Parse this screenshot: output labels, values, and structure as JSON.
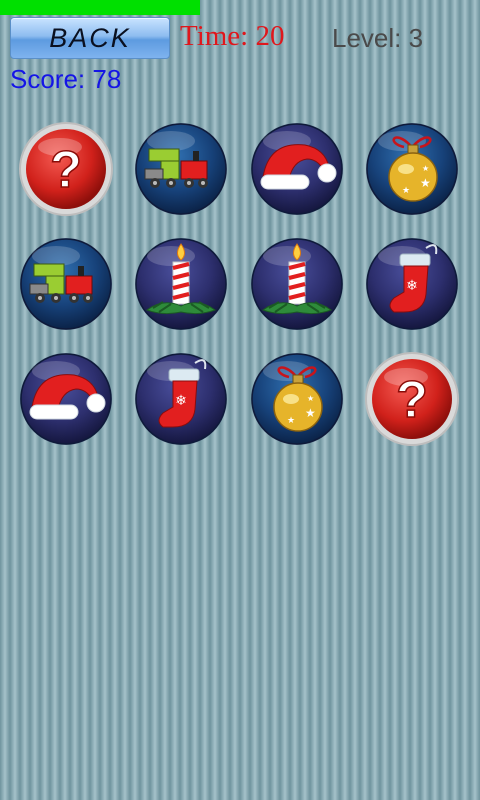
{
  "header": {
    "back_label": "BACK",
    "time_text": "Time: 20",
    "level_text": "Level: 3",
    "score_text": "Score: 78"
  },
  "grid": {
    "columns": 4,
    "cards": [
      {
        "face": "question",
        "revealed": false
      },
      {
        "face": "train",
        "revealed": true
      },
      {
        "face": "santa-hat",
        "revealed": true
      },
      {
        "face": "ornament",
        "revealed": true
      },
      {
        "face": "train",
        "revealed": true
      },
      {
        "face": "candle",
        "revealed": true
      },
      {
        "face": "candle",
        "revealed": true
      },
      {
        "face": "stocking",
        "revealed": true
      },
      {
        "face": "santa-hat",
        "revealed": true
      },
      {
        "face": "stocking",
        "revealed": true
      },
      {
        "face": "ornament",
        "revealed": true
      },
      {
        "face": "question",
        "revealed": false
      }
    ]
  },
  "colors": {
    "progress": "#00e000",
    "time": "#e0171c",
    "score": "#1515e6",
    "level": "#4a4a4a"
  }
}
